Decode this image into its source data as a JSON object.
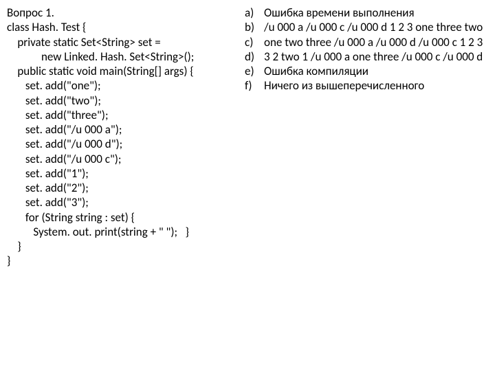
{
  "question": {
    "title": "Вопрос 1.",
    "code_lines": [
      "class Hash. Test {",
      "    private static Set<String> set =",
      "             new Linked. Hash. Set<String>();",
      "    public static void main(String[] args) {",
      "       set. add(\"one\");",
      "       set. add(\"two\");",
      "       set. add(\"three\");",
      "       set. add(\"/u 000 a\");",
      "       set. add(\"/u 000 d\");",
      "       set. add(\"/u 000 c\");",
      "       set. add(\"1\");",
      "       set. add(\"2\");",
      "       set. add(\"3\");",
      "       for (String string : set) {",
      "          System. out. print(string + \" \");   }",
      "    }",
      "}"
    ]
  },
  "options": [
    {
      "letter": "a)",
      "text": "Ошибка времени выполнения"
    },
    {
      "letter": "b)",
      "text": "/u 000 a /u 000 c /u 000 d 1 2 3 one three two"
    },
    {
      "letter": "c)",
      "text": "one two three /u 000 a /u 000 d /u 000 c 1 2 3"
    },
    {
      "letter": "d)",
      "text": "3 2 two 1 /u 000 a one three /u 000 c /u 000 d"
    },
    {
      "letter": "e)",
      "text": "Ошибка компиляции"
    },
    {
      "letter": "f)",
      "text": "Ничего из вышеперечисленного"
    }
  ]
}
